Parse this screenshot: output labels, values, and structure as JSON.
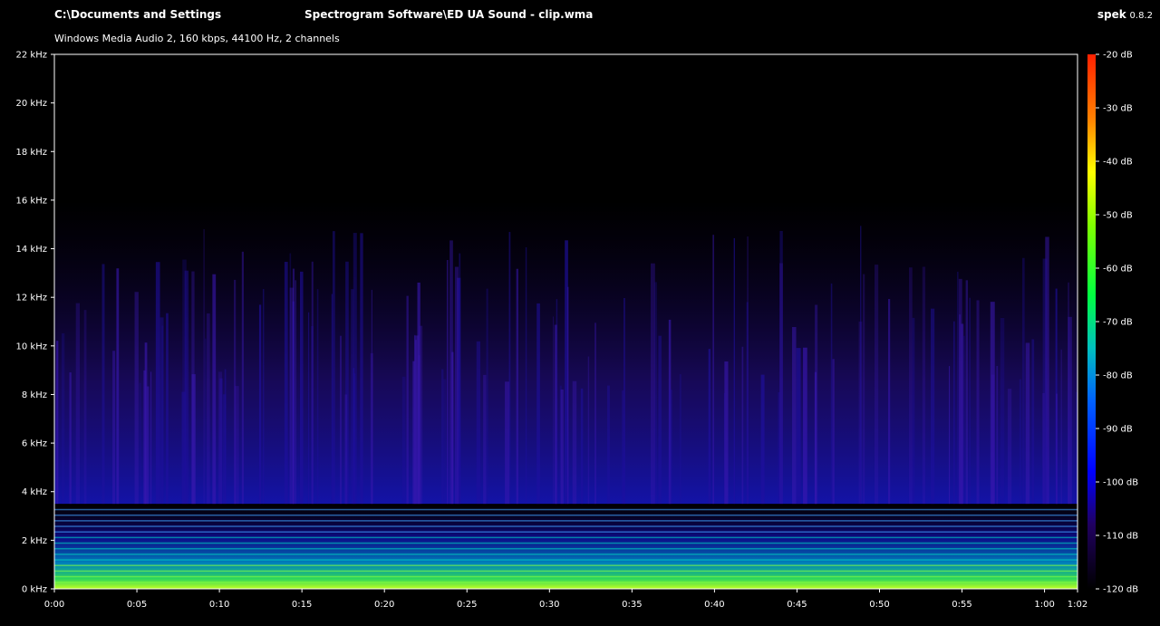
{
  "header": {
    "path_left": "C:\\Documents and Settings",
    "path_mid": "Spectrogram Software\\ED UA Sound - clip.wma",
    "app_name": "spek",
    "app_version": "0.8.2",
    "file_info": "Windows Media Audio 2, 160 kbps, 44100 Hz, 2 channels"
  },
  "chart_data": {
    "type": "heatmap",
    "title": "",
    "x_axis": {
      "label": "",
      "unit": "time",
      "range_seconds": [
        0,
        62
      ],
      "ticks": [
        "0:00",
        "0:05",
        "0:10",
        "0:15",
        "0:20",
        "0:25",
        "0:30",
        "0:35",
        "0:40",
        "0:45",
        "0:50",
        "0:55",
        "1:00",
        "1:02"
      ],
      "tick_seconds": [
        0,
        5,
        10,
        15,
        20,
        25,
        30,
        35,
        40,
        45,
        50,
        55,
        60,
        62
      ]
    },
    "y_axis": {
      "label": "",
      "unit": "kHz",
      "range": [
        0,
        22
      ],
      "ticks": [
        "0 kHz",
        "2 kHz",
        "4 kHz",
        "6 kHz",
        "8 kHz",
        "10 kHz",
        "12 kHz",
        "14 kHz",
        "16 kHz",
        "18 kHz",
        "20 kHz",
        "22 kHz"
      ],
      "tick_values": [
        0,
        2,
        4,
        6,
        8,
        10,
        12,
        14,
        16,
        18,
        20,
        22
      ]
    },
    "colorbar": {
      "unit": "dB",
      "range": [
        -120,
        -20
      ],
      "ticks": [
        "-20 dB",
        "-30 dB",
        "-40 dB",
        "-50 dB",
        "-60 dB",
        "-70 dB",
        "-80 dB",
        "-90 dB",
        "-100 dB",
        "-110 dB",
        "-120 dB"
      ],
      "tick_values": [
        -20,
        -30,
        -40,
        -50,
        -60,
        -70,
        -80,
        -90,
        -100,
        -110,
        -120
      ],
      "colors": [
        "#ff2000",
        "#ff8000",
        "#ffff00",
        "#80ff00",
        "#00ff40",
        "#00c0c0",
        "#0080ff",
        "#0000ff",
        "#200080",
        "#000000"
      ]
    },
    "grid": false,
    "background": "#000000",
    "plot_border": "#ffffff"
  }
}
